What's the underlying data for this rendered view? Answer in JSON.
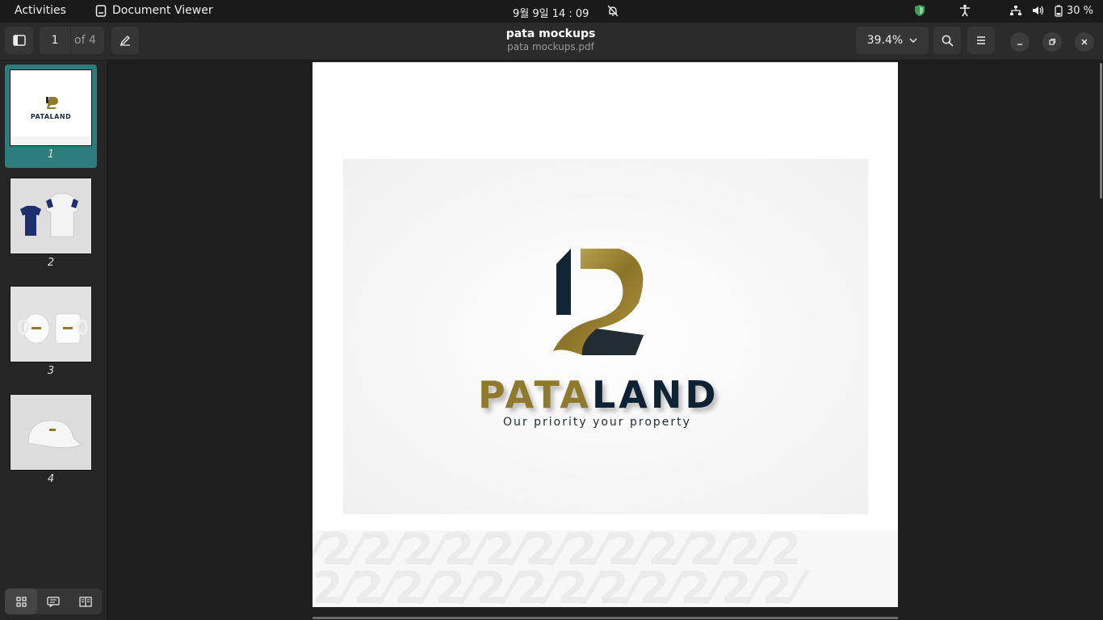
{
  "topbar": {
    "activities": "Activities",
    "app_name": "Document Viewer",
    "clock": "9월 9일  14 : 09",
    "battery": "30 %"
  },
  "header": {
    "current_page": "1",
    "page_total": "of 4",
    "title": "pata mockups",
    "subtitle": "pata mockups.pdf",
    "zoom": "39.4%"
  },
  "sidebar": {
    "thumbnails": [
      {
        "label": "1",
        "selected": true
      },
      {
        "label": "2",
        "selected": false
      },
      {
        "label": "3",
        "selected": false
      },
      {
        "label": "4",
        "selected": false
      }
    ]
  },
  "document": {
    "brand_part1": "PATA",
    "brand_part2": "LAND",
    "tagline": "Our priority your property",
    "thumb_brand": "PATALAND"
  },
  "colors": {
    "accent": "#2d7d7d",
    "gold": "#8f7a2c",
    "navy": "#0f2233"
  }
}
